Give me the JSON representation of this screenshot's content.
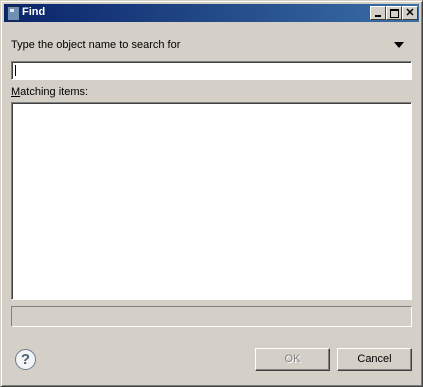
{
  "window": {
    "title": "Find",
    "minimize_glyph": "_",
    "maximize_glyph": "□",
    "close_glyph": "✕"
  },
  "search": {
    "prompt": "Type the object name to search for",
    "value": "",
    "placeholder": ""
  },
  "results": {
    "label_mnemonic": "M",
    "label_rest": "atching items:",
    "items": []
  },
  "status": {
    "text": ""
  },
  "buttons": {
    "help": "?",
    "ok": "OK",
    "cancel": "Cancel",
    "ok_enabled": false
  },
  "colors": {
    "title_bar_start": "#0a246a",
    "title_bar_end": "#3a6ea5",
    "dialog_face": "#d4d0c8"
  }
}
